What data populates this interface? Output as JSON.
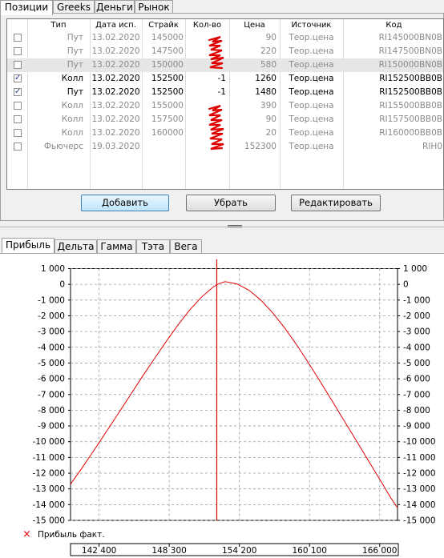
{
  "top_tabs": [
    "Позиции",
    "Greeks",
    "Деньги",
    "Рынок"
  ],
  "columns": [
    "Тип",
    "Дата исп.",
    "Страйк",
    "Кол-во",
    "Цена",
    "Источник",
    "Код"
  ],
  "rows": [
    {
      "checked": false,
      "active": false,
      "selected": false,
      "type": "Пут",
      "date": "13.02.2020",
      "strike": "145000",
      "qty": "",
      "price": "90",
      "source": "Теор.цена",
      "code": "RI145000BN0B"
    },
    {
      "checked": false,
      "active": false,
      "selected": false,
      "type": "Пут",
      "date": "13.02.2020",
      "strike": "147500",
      "qty": "",
      "price": "220",
      "source": "Теор.цена",
      "code": "RI147500BN0B"
    },
    {
      "checked": false,
      "active": false,
      "selected": true,
      "type": "Пут",
      "date": "13.02.2020",
      "strike": "150000",
      "qty": "",
      "price": "580",
      "source": "Теор.цена",
      "code": "RI150000BN0B"
    },
    {
      "checked": true,
      "active": true,
      "selected": false,
      "type": "Колл",
      "date": "13.02.2020",
      "strike": "152500",
      "qty": "-1",
      "price": "1260",
      "source": "Теор.цена",
      "code": "RI152500BB0B"
    },
    {
      "checked": true,
      "active": true,
      "selected": false,
      "type": "Пут",
      "date": "13.02.2020",
      "strike": "152500",
      "qty": "-1",
      "price": "1480",
      "source": "Теор.цена",
      "code": "RI152500BB0B"
    },
    {
      "checked": false,
      "active": false,
      "selected": false,
      "type": "Колл",
      "date": "13.02.2020",
      "strike": "155000",
      "qty": "",
      "price": "390",
      "source": "Теор.цена",
      "code": "RI155000BB0B"
    },
    {
      "checked": false,
      "active": false,
      "selected": false,
      "type": "Колл",
      "date": "13.02.2020",
      "strike": "157500",
      "qty": "",
      "price": "90",
      "source": "Теор.цена",
      "code": "RI157500BB0B"
    },
    {
      "checked": false,
      "active": false,
      "selected": false,
      "type": "Колл",
      "date": "13.02.2020",
      "strike": "160000",
      "qty": "",
      "price": "20",
      "source": "Теор.цена",
      "code": "RI160000BB0B"
    },
    {
      "checked": false,
      "active": false,
      "selected": false,
      "type": "Фьючерс",
      "date": "19.03.2020",
      "strike": "",
      "qty": "",
      "price": "152300",
      "source": "Теор.цена",
      "code": "RIH0"
    }
  ],
  "buttons": {
    "add": "Добавить",
    "remove": "Убрать",
    "edit": "Редактировать"
  },
  "bottom_tabs": [
    "Прибыль",
    "Дельта",
    "Гамма",
    "Тэта",
    "Вега"
  ],
  "legend_label": "Прибыль факт.",
  "colors": {
    "curve": "#e00000",
    "annotation": "#e00000",
    "check": "#2a3b8f"
  },
  "chart_data": {
    "type": "line",
    "series": [
      {
        "name": "Прибыль факт.",
        "points": [
          [
            140000,
            -12700
          ],
          [
            141000,
            -11630
          ],
          [
            142000,
            -10520
          ],
          [
            143000,
            -9380
          ],
          [
            144000,
            -8230
          ],
          [
            145000,
            -7070
          ],
          [
            146000,
            -5910
          ],
          [
            147000,
            -4780
          ],
          [
            148000,
            -3680
          ],
          [
            149000,
            -2620
          ],
          [
            150000,
            -1650
          ],
          [
            151000,
            -820
          ],
          [
            152000,
            -170
          ],
          [
            152500,
            50
          ],
          [
            153000,
            170
          ],
          [
            154000,
            30
          ],
          [
            155000,
            -370
          ],
          [
            156000,
            -1000
          ],
          [
            157000,
            -1810
          ],
          [
            158000,
            -2760
          ],
          [
            159000,
            -3830
          ],
          [
            160000,
            -4980
          ],
          [
            161000,
            -6180
          ],
          [
            162000,
            -7410
          ],
          [
            163000,
            -8650
          ],
          [
            164000,
            -9890
          ],
          [
            165000,
            -11140
          ],
          [
            166000,
            -12380
          ],
          [
            167000,
            -13650
          ],
          [
            167500,
            -14200
          ]
        ]
      }
    ],
    "vline_x": 152300,
    "xlim": [
      140000,
      167500
    ],
    "ylim": [
      -15000,
      1000
    ],
    "x_ticks": [
      142400,
      148300,
      154200,
      160100,
      166000
    ],
    "x_tick_labels": [
      "142 400",
      "148 300",
      "154 200",
      "160 100",
      "166 000"
    ],
    "y_ticks": [
      1000,
      0,
      -1000,
      -2000,
      -3000,
      -4000,
      -5000,
      -6000,
      -7000,
      -8000,
      -9000,
      -10000,
      -11000,
      -12000,
      -13000,
      -14000,
      -15000
    ],
    "y_tick_labels": [
      "1 000",
      "0",
      "-1 000",
      "-2 000",
      "-3 000",
      "-4 000",
      "-5 000",
      "-6 000",
      "-7 000",
      "-8 000",
      "-9 000",
      "-10 000",
      "-11 000",
      "-12 000",
      "-13 000",
      "-14 000",
      "-15 000"
    ],
    "grid": true
  }
}
